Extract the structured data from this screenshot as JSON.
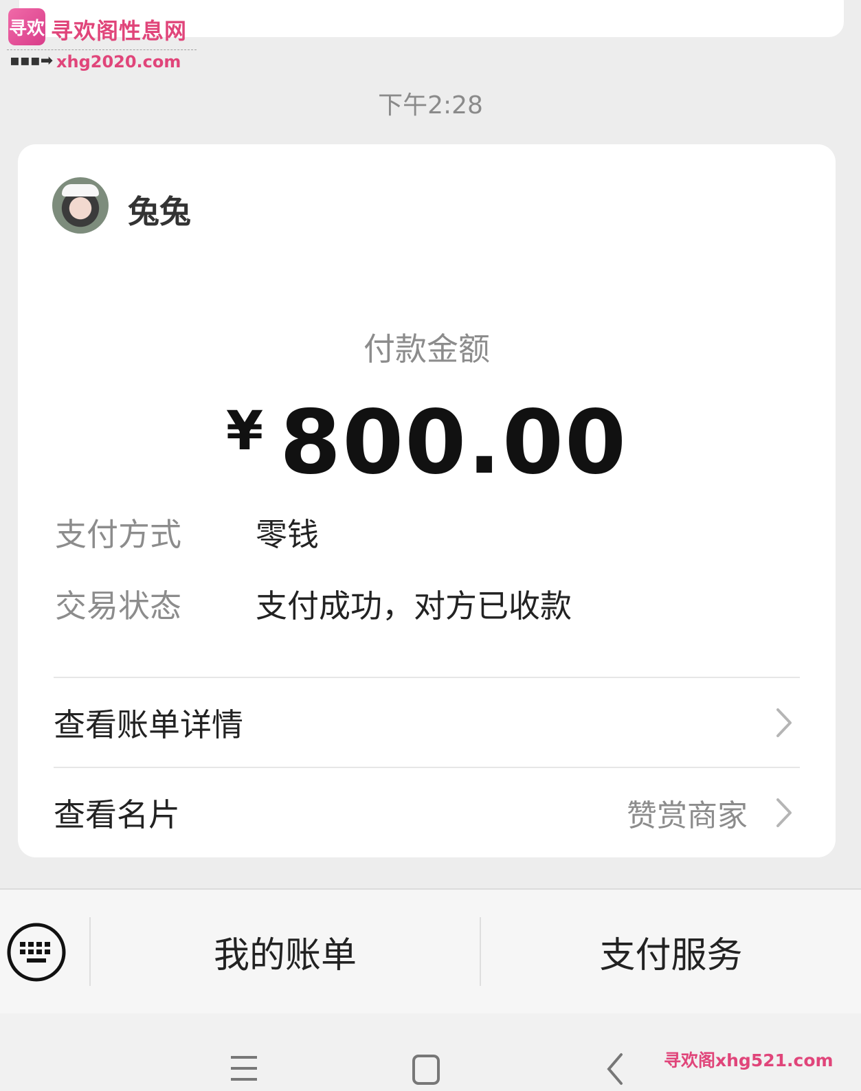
{
  "watermark": {
    "logo_text": "寻欢",
    "site_name": "寻欢阁性息网",
    "url": "xhg2020.com",
    "bottom_text": "寻欢阁xhg521.com"
  },
  "chat": {
    "timestamp": "下午2:28"
  },
  "payment_card": {
    "payee_name": "兔兔",
    "amount_label": "付款金额",
    "currency_symbol": "¥",
    "amount": "800.00",
    "details": [
      {
        "key": "支付方式",
        "value": "零钱"
      },
      {
        "key": "交易状态",
        "value": "支付成功，对方已收款"
      }
    ],
    "links": [
      {
        "label": "查看账单详情",
        "extra": ""
      },
      {
        "label": "查看名片",
        "extra": "赞赏商家"
      }
    ]
  },
  "bottom_menu": {
    "items": [
      "我的账单",
      "支付服务"
    ]
  },
  "icons": {
    "keyboard": "keyboard-icon",
    "chevron": "chevron-right-icon",
    "nav_menu": "menu-icon",
    "nav_home": "home-icon",
    "nav_back": "back-icon"
  }
}
